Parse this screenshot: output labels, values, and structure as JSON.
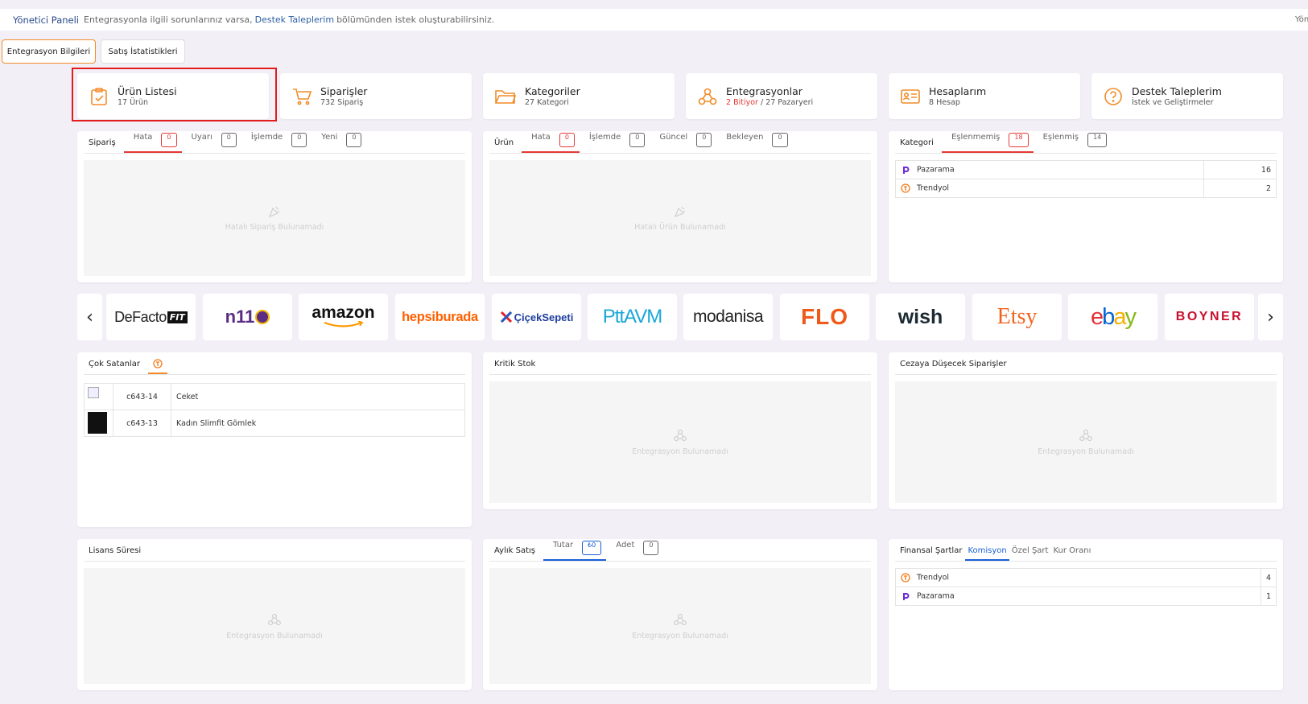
{
  "topbar": {
    "brand": "Yönetici Paneli",
    "message_prefix": "Entegrasyonla ilgili sorunlarınız varsa,",
    "message_link": "Destek Taleplerim",
    "message_suffix": "bölümünden istek oluşturabilirsiniz.",
    "right_text": "Yön"
  },
  "tabs": [
    {
      "label": "Entegrasyon Bilgileri",
      "active": true
    },
    {
      "label": "Satış İstatistikleri",
      "active": false
    }
  ],
  "stats": {
    "products": {
      "title": "Ürün Listesi",
      "sub": "17 Ürün",
      "icon": "clipboard-check-icon"
    },
    "orders": {
      "title": "Siparişler",
      "sub": "732 Sipariş",
      "icon": "cart-icon"
    },
    "categories": {
      "title": "Kategoriler",
      "sub": "27 Kategori",
      "icon": "folder-icon"
    },
    "integrations": {
      "title": "Entegrasyonlar",
      "sub_red": "2 Bitiyor",
      "sub_rest": "/ 27 Pazaryeri",
      "icon": "integration-icon"
    },
    "accounts": {
      "title": "Hesaplarım",
      "sub": "8 Hesap",
      "icon": "id-card-icon"
    },
    "support": {
      "title": "Destek Taleplerim",
      "sub": "İstek ve Geliştirmeler",
      "icon": "question-icon"
    }
  },
  "order_panel": {
    "title": "Sipariş",
    "tabs": [
      {
        "label": "Hata",
        "count": "0"
      },
      {
        "label": "Uyarı",
        "count": "0"
      },
      {
        "label": "İşlemde",
        "count": "0"
      },
      {
        "label": "Yeni",
        "count": "0"
      }
    ],
    "empty": "Hatalı Sipariş Bulunamadı"
  },
  "product_panel": {
    "title": "Ürün",
    "tabs": [
      {
        "label": "Hata",
        "count": "0"
      },
      {
        "label": "İşlemde",
        "count": "0"
      },
      {
        "label": "Güncel",
        "count": "0"
      },
      {
        "label": "Bekleyen",
        "count": "0"
      }
    ],
    "empty": "Hatalı Ürün Bulunamadı"
  },
  "category_panel": {
    "title": "Kategori",
    "tabs": [
      {
        "label": "Eşlenmemiş",
        "count": "18"
      },
      {
        "label": "Eşlenmiş",
        "count": "14"
      }
    ],
    "rows": [
      {
        "name": "Pazarama",
        "value": "16"
      },
      {
        "name": "Trendyol",
        "value": "2"
      }
    ]
  },
  "marketplaces": {
    "prev": "‹",
    "next": "›",
    "logos": [
      {
        "name": "DeFacto",
        "suffix": "FIT"
      },
      {
        "name": "n11"
      },
      {
        "name": "amazon"
      },
      {
        "name": "hepsiburada"
      },
      {
        "name": "ÇiçekSepeti"
      },
      {
        "name": "PttAVM"
      },
      {
        "name": "modanisa"
      },
      {
        "name": "FLO"
      },
      {
        "name": "wish"
      },
      {
        "name": "Etsy"
      },
      {
        "name": "ebay"
      },
      {
        "name": "BOYNER"
      }
    ]
  },
  "best_sellers": {
    "title": "Çok Satanlar",
    "rows": [
      {
        "code": "c643-14",
        "name": "Ceket"
      },
      {
        "code": "c643-13",
        "name": "Kadın Slimfit Gömlek"
      }
    ]
  },
  "critical_stock": {
    "title": "Kritik Stok",
    "empty": "Entegrasyon Bulunamadı"
  },
  "penalty_orders": {
    "title": "Cezaya Düşecek Siparişler",
    "empty": "Entegrasyon Bulunamadı"
  },
  "license": {
    "title": "Lisans Süresi",
    "empty": "Entegrasyon Bulunamadı"
  },
  "monthly_sales": {
    "title": "Aylık Satış",
    "tabs": [
      {
        "label": "Tutar",
        "count": "₺0"
      },
      {
        "label": "Adet",
        "count": "0"
      }
    ],
    "empty": "Entegrasyon Bulunamadı"
  },
  "financial": {
    "title": "Finansal Şartlar",
    "tabs": [
      "Komisyon",
      "Özel Şart",
      "Kur Oranı"
    ],
    "rows": [
      {
        "name": "Trendyol",
        "value": "4"
      },
      {
        "name": "Pazarama",
        "value": "1"
      }
    ]
  },
  "colors": {
    "accent": "#f28c28",
    "error": "#e53935",
    "link": "#1a5fd6",
    "highlight": "#e21b1b"
  }
}
